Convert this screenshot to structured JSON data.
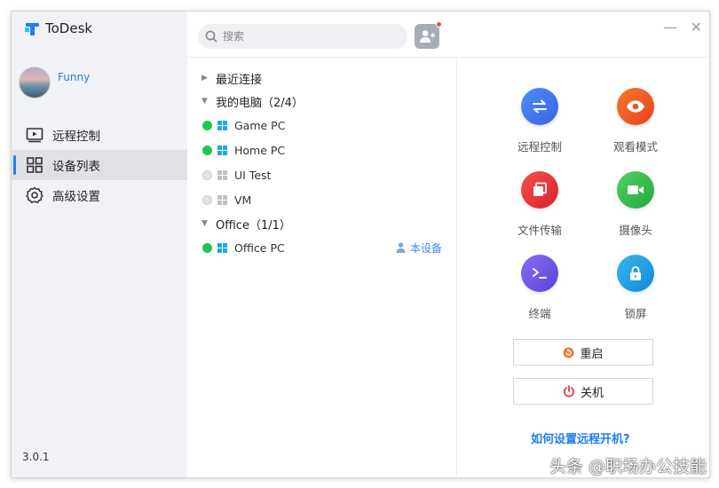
{
  "app": {
    "name": "ToDesk",
    "version": "3.0.1"
  },
  "user": {
    "name": "Funny"
  },
  "sidebar": {
    "items": [
      {
        "label": "远程控制",
        "icon": "monitor-play-icon"
      },
      {
        "label": "设备列表",
        "icon": "grid-icon",
        "active": true
      },
      {
        "label": "高级设置",
        "icon": "gear-icon"
      }
    ]
  },
  "search": {
    "placeholder": "搜索",
    "value": ""
  },
  "tree": {
    "groups": [
      {
        "label": "最近连接",
        "expanded": false
      },
      {
        "label": "我的电脑（2/4）",
        "expanded": true
      },
      {
        "label": "Office（1/1）",
        "expanded": true
      }
    ],
    "devices": [
      {
        "name": "Game PC",
        "online": true
      },
      {
        "name": "Home PC",
        "online": true
      },
      {
        "name": "UI Test",
        "online": false
      },
      {
        "name": "VM",
        "online": false
      },
      {
        "name": "Office PC",
        "online": true
      }
    ],
    "this_device_label": "本设备"
  },
  "actions": {
    "remote_control": "远程控制",
    "view_mode": "观看模式",
    "file_transfer": "文件传输",
    "camera": "摄像头",
    "terminal": "终端",
    "lock_screen": "锁屏",
    "restart": "重启",
    "shutdown": "关机",
    "howto_link": "如何设置远程开机?"
  },
  "colors": {
    "accent": "#1f7ef5",
    "remote": "#3a6ff0",
    "view": "#ee5a1e",
    "file": "#ea2d37",
    "camera": "#33c24a",
    "terminal": "#6f58e8",
    "lock": "#1a9fe3",
    "online": "#23c552"
  },
  "watermark": "头条 @职场办公技能"
}
